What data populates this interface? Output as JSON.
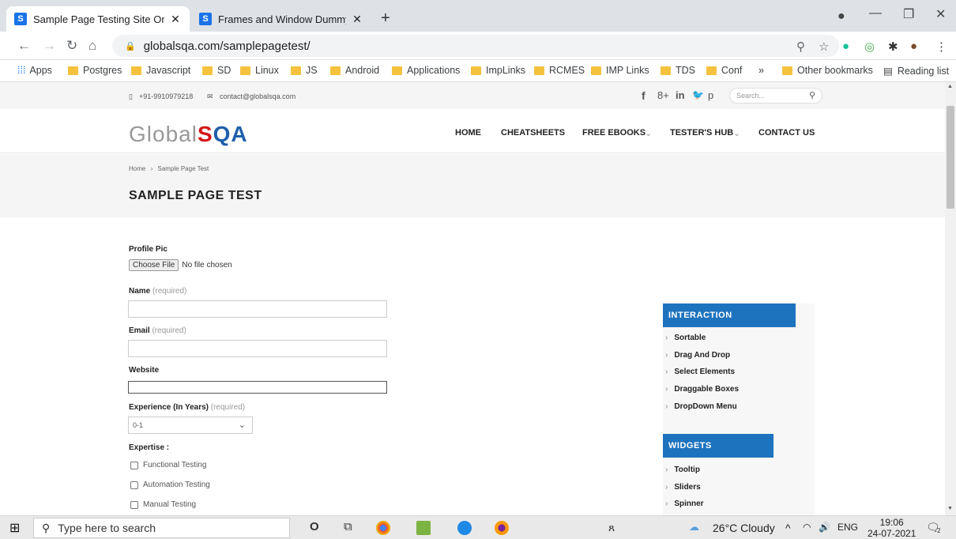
{
  "browser": {
    "tabs": [
      {
        "title": "Sample Page Testing Site Online",
        "favicon": "S"
      },
      {
        "title": "Frames and Window Dummy Tes",
        "favicon": "S"
      }
    ],
    "url": "globalsqa.com/samplepagetest/",
    "bookmarks": [
      "Apps",
      "Postgres",
      "Javascript",
      "SD",
      "Linux",
      "JS",
      "Android",
      "Applications",
      "ImpLinks",
      "RCMES",
      "IMP Links",
      "TDS",
      "Conf"
    ],
    "overflow": "»",
    "other_bookmarks": "Other bookmarks",
    "reading_list": "Reading list"
  },
  "topbar": {
    "phone": "+91-9910979218",
    "email": "contact@globalsqa.com",
    "social": [
      "f",
      "8+",
      "in",
      "tw",
      "p"
    ],
    "search_placeholder": "Search..."
  },
  "header": {
    "logo_part1": "Global",
    "logo_part2": "S",
    "logo_part3": "QA",
    "menu": [
      "HOME",
      "CHEATSHEETS",
      "FREE EBOOKS",
      "TESTER'S HUB",
      "CONTACT US"
    ]
  },
  "banner": {
    "crumb_home": "Home",
    "crumb_sep": "›",
    "crumb_current": "Sample Page Test",
    "title": "SAMPLE PAGE TEST"
  },
  "form": {
    "profile_pic_label": "Profile Pic",
    "choose_file": "Choose File",
    "no_file": "No file chosen",
    "name_label": "Name",
    "required": "(required)",
    "email_label": "Email",
    "website_label": "Website",
    "experience_label": "Experience (In Years)",
    "experience_value": "0-1",
    "expertise_label": "Expertise :",
    "expertise_options": [
      "Functional Testing",
      "Automation Testing",
      "Manual Testing"
    ]
  },
  "sidebar": {
    "interaction_title": "INTERACTION",
    "interaction_items": [
      "Sortable",
      "Drag And Drop",
      "Select Elements",
      "Draggable Boxes",
      "DropDown Menu"
    ],
    "widgets_title": "WIDGETS",
    "widgets_items": [
      "Tooltip",
      "Sliders",
      "Spinner"
    ]
  },
  "taskbar": {
    "search_placeholder": "Type here to search",
    "weather": "26°C  Cloudy",
    "lang": "ENG",
    "time": "19:06",
    "date": "24-07-2021",
    "notif_count": "2"
  }
}
